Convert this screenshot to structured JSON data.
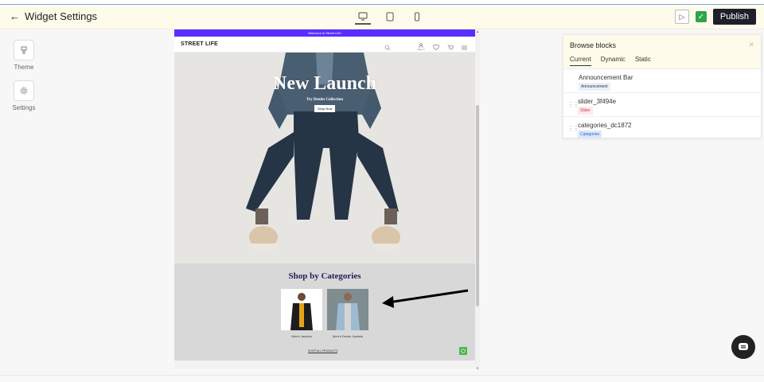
{
  "header": {
    "back_label": "Widget Settings",
    "publish_label": "Publish"
  },
  "left_sidebar": {
    "items": [
      {
        "label": "Theme",
        "icon": "paint-icon"
      },
      {
        "label": "Settings",
        "icon": "gear-icon"
      }
    ]
  },
  "preview": {
    "announcement": "Welcome to Street Life!",
    "brand": "STREET LIFE",
    "nav": {
      "sign_in": "Sign In"
    },
    "hero": {
      "title": "New Launch",
      "subtitle": "Try Denim Collection",
      "button": "Shop Now"
    },
    "categories": {
      "title": "Shop by Categories",
      "items": [
        {
          "label": "Men's Jackets"
        },
        {
          "label": "Men's Denim Jackets"
        }
      ],
      "shop_all": "SHOP ALL PRODUCTS"
    }
  },
  "blocks_panel": {
    "title": "Browse blocks",
    "tabs": [
      "Current",
      "Dynamic",
      "Static"
    ],
    "active_tab": "Current",
    "blocks": [
      {
        "name": "Announcement Bar",
        "tag": "Announcement"
      },
      {
        "name": "slider_3f494e",
        "tag": "Slider"
      },
      {
        "name": "categories_dc1872",
        "tag": "Categories"
      }
    ]
  },
  "colors": {
    "announcement_bg": "#5a2dff",
    "publish_bg": "#1f1f2b",
    "check_green": "#2fa34a",
    "category_title": "#22205a"
  }
}
